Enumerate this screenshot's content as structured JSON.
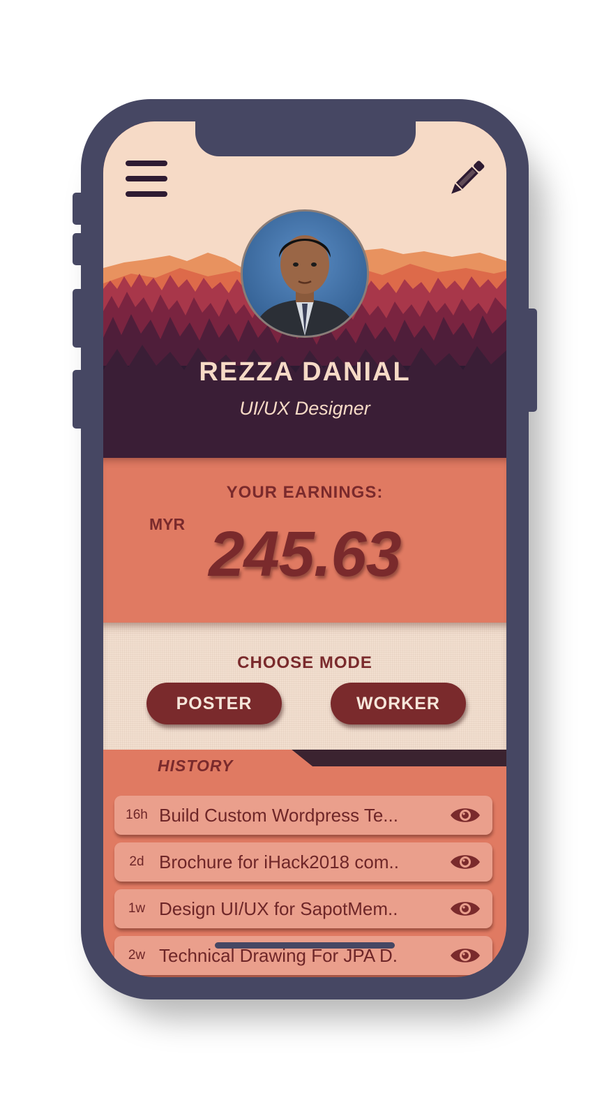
{
  "header": {
    "menu_icon": "hamburger-icon",
    "edit_icon": "pencil-icon"
  },
  "profile": {
    "name": "REZZA DANIAL",
    "role": "UI/UX Designer"
  },
  "earnings": {
    "label": "YOUR EARNINGS:",
    "currency": "MYR",
    "amount": "245.63"
  },
  "mode": {
    "label": "CHOOSE MODE",
    "buttons": [
      "POSTER",
      "WORKER"
    ]
  },
  "history": {
    "label": "HISTORY",
    "items": [
      {
        "age": "16h",
        "title": "Build Custom Wordpress Te..."
      },
      {
        "age": "2d",
        "title": "Brochure for iHack2018 com.."
      },
      {
        "age": "1w",
        "title": "Design UI/UX for SapotMem.."
      },
      {
        "age": "2w",
        "title": "Technical Drawing For JPA D."
      }
    ]
  },
  "colors": {
    "frame": "#464763",
    "cream": "#f6dac6",
    "dark_plum": "#2e1b32",
    "coral": "#e07a62",
    "maroon": "#7a2a2c"
  }
}
